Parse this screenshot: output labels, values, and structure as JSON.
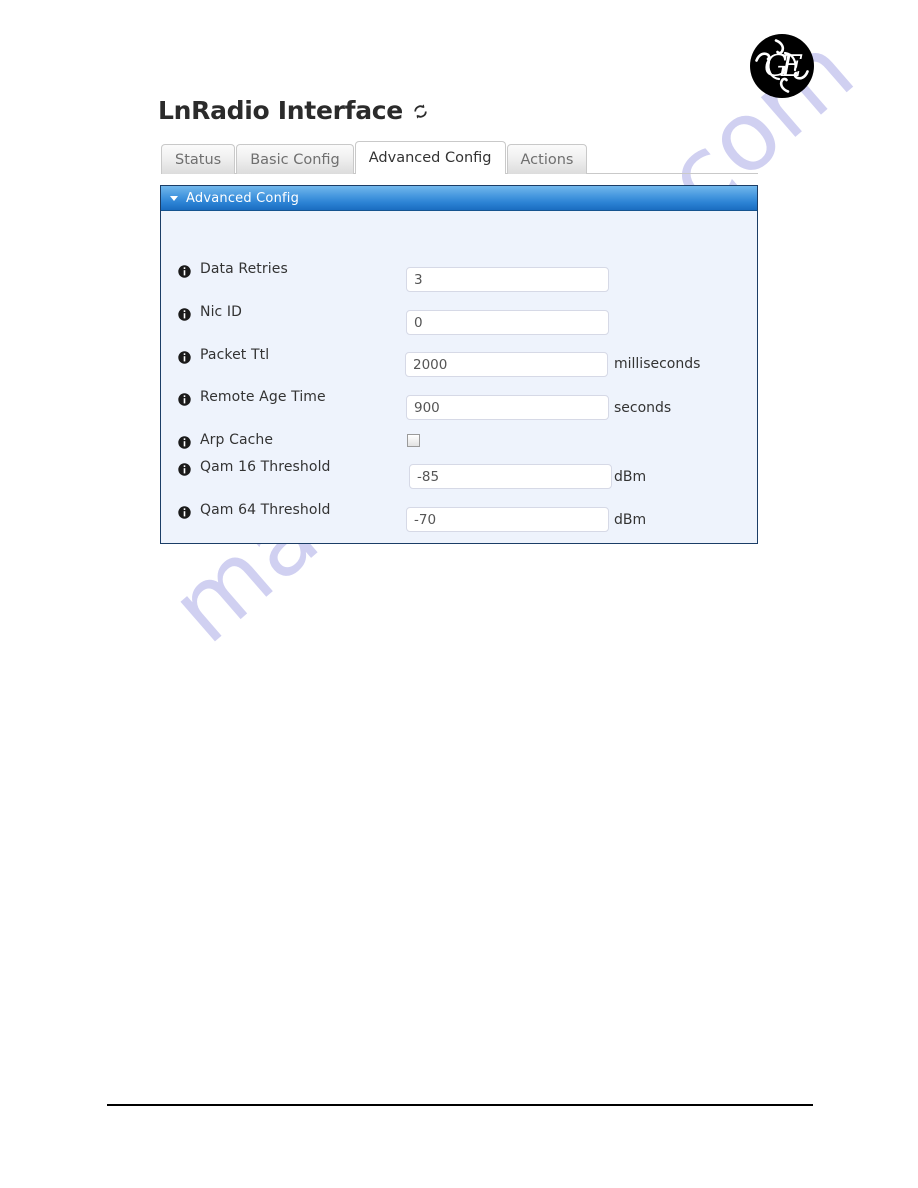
{
  "brand": {
    "logo_name": "ge-monogram-logo",
    "logo_alt": "GE"
  },
  "page": {
    "title": "LnRadio Interface",
    "refresh_icon": "refresh-icon"
  },
  "tabs": [
    {
      "label": "Status",
      "active": false
    },
    {
      "label": "Basic Config",
      "active": false
    },
    {
      "label": "Advanced Config",
      "active": true
    },
    {
      "label": "Actions",
      "active": false
    }
  ],
  "panel": {
    "title": "Advanced Config",
    "collapse_icon": "caret-down-icon",
    "header_color": "#2b82d4",
    "border_color": "#1b3d66",
    "body_color": "#eef3fc"
  },
  "fields": [
    {
      "label": "Data Retries",
      "info_icon": "info-icon",
      "type": "text",
      "value": "3",
      "unit": ""
    },
    {
      "label": "Nic ID",
      "info_icon": "info-icon",
      "type": "text",
      "value": "0",
      "unit": ""
    },
    {
      "label": "Packet Ttl",
      "info_icon": "info-icon",
      "type": "text",
      "value": "2000",
      "unit": "milliseconds"
    },
    {
      "label": "Remote Age Time",
      "info_icon": "info-icon",
      "type": "text",
      "value": "900",
      "unit": "seconds"
    },
    {
      "label": "Arp Cache",
      "info_icon": "info-icon",
      "type": "checkbox",
      "checked": false,
      "unit": ""
    },
    {
      "label": "Qam 16 Threshold",
      "info_icon": "info-icon",
      "type": "text",
      "value": "-85",
      "unit": "dBm"
    },
    {
      "label": "Qam 64 Threshold",
      "info_icon": "info-icon",
      "type": "text",
      "value": "-70",
      "unit": "dBm"
    }
  ],
  "watermark": {
    "text": "manualshive.com",
    "color": "#c8c8ef"
  }
}
